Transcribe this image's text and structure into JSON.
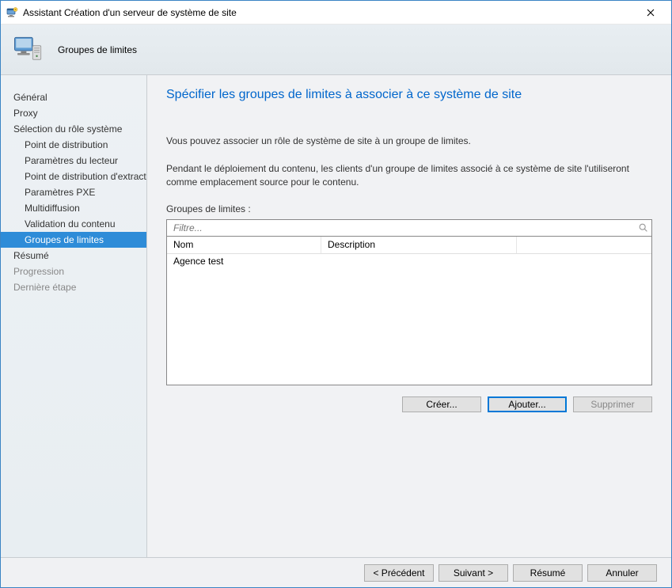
{
  "window": {
    "title": "Assistant Création d'un serveur de système de site"
  },
  "header": {
    "page_label": "Groupes de limites"
  },
  "sidebar": {
    "items": [
      {
        "label": "Général",
        "kind": "normal"
      },
      {
        "label": "Proxy",
        "kind": "normal"
      },
      {
        "label": "Sélection du rôle système",
        "kind": "normal"
      },
      {
        "label": "Point de distribution",
        "kind": "sub"
      },
      {
        "label": "Paramètres du lecteur",
        "kind": "sub"
      },
      {
        "label": "Point de distribution d'extraction",
        "kind": "sub"
      },
      {
        "label": "Paramètres PXE",
        "kind": "sub"
      },
      {
        "label": "Multidiffusion",
        "kind": "sub"
      },
      {
        "label": "Validation du contenu",
        "kind": "sub"
      },
      {
        "label": "Groupes de limites",
        "kind": "sub selected"
      },
      {
        "label": "Résumé",
        "kind": "normal"
      },
      {
        "label": "Progression",
        "kind": "dim"
      },
      {
        "label": "Dernière étape",
        "kind": "dim"
      }
    ]
  },
  "content": {
    "title": "Spécifier les groupes de limites à associer à ce système de site",
    "desc1": "Vous pouvez associer un rôle de système de site à un groupe de limites.",
    "desc2": "Pendant le déploiement du contenu, les clients d'un groupe de limites associé à ce système de site l'utiliseront comme emplacement source pour le contenu.",
    "list_label": "Groupes de limites :",
    "filter_placeholder": "Filtre...",
    "columns": {
      "name": "Nom",
      "description": "Description"
    },
    "rows": [
      {
        "name": "Agence test",
        "description": ""
      }
    ],
    "buttons": {
      "create": "Créer...",
      "add": "Ajouter...",
      "remove": "Supprimer"
    }
  },
  "footer": {
    "prev": "< Précédent",
    "next": "Suivant >",
    "summary": "Résumé",
    "cancel": "Annuler"
  }
}
